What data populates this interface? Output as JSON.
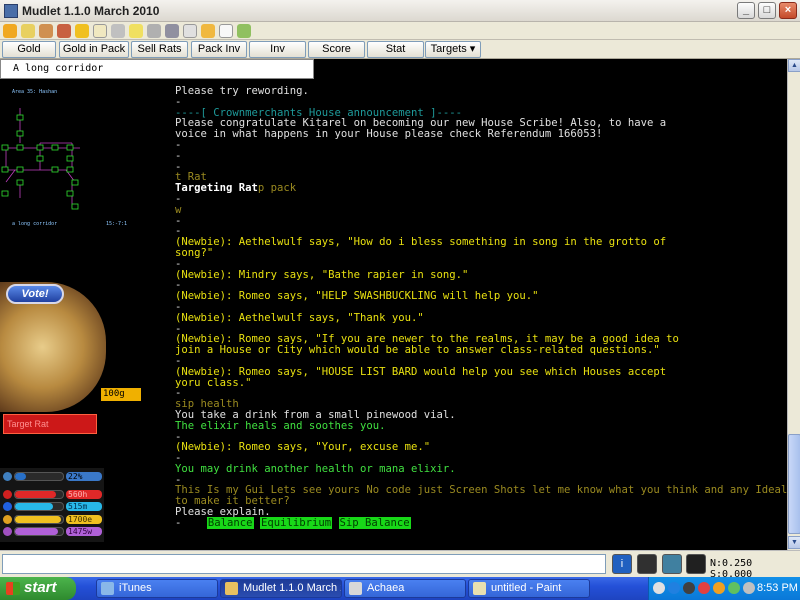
{
  "window": {
    "title": "Mudlet 1.1.0 March 2010",
    "controls": {
      "minimize": "_",
      "maximize": "□",
      "close": "×"
    }
  },
  "toolbar_icons": [
    "power-icon",
    "magic-icon",
    "connect-icon",
    "timer-icon",
    "star-icon",
    "edit-icon",
    "grid-icon",
    "lightbulb-icon",
    "wrench-icon",
    "plugin-icon",
    "help-icon",
    "notepad-icon",
    "window-icon",
    "headphones-icon"
  ],
  "buttons": [
    "Gold",
    "Gold in Pack",
    "Sell Rats",
    "Pack Inv",
    "Inv",
    "Score",
    "Stat"
  ],
  "targets_dropdown": "Targets ▾",
  "room_name": "A long corridor",
  "minimap": {
    "area": "Area 35: Hashan",
    "room": "a long corridor",
    "coords": "15:-7:1"
  },
  "gui": {
    "vote_label": "Vote!",
    "gold": "100g",
    "target": "Target Rat"
  },
  "stats": {
    "percent": "22%",
    "health": "560h",
    "mana": "515m",
    "endurance": "1700e",
    "willpower": "1475w",
    "health_level": 0.85,
    "mana_level": 0.8,
    "endurance_level": 0.95,
    "willpower_level": 0.9,
    "percent_level": 0.22
  },
  "output_lines": [
    {
      "t": "Please try rewording.",
      "c": "c-w"
    },
    {
      "t": "-",
      "c": "c-w"
    },
    {
      "t": "----[ Crownmerchants House announcement ]----",
      "c": "c-b"
    },
    {
      "t": "Please congratulate Kitarel on becoming our new House Scribe! Also, to have a",
      "c": "c-w"
    },
    {
      "t": "voice in what happens in your House please check Referendum 166053!",
      "c": "c-w"
    },
    {
      "t": "-",
      "c": "c-w"
    },
    {
      "t": "-",
      "c": "c-w"
    },
    {
      "t": "-",
      "c": "c-w"
    },
    {
      "t": "t Rat",
      "c": "c-o"
    },
    {
      "t": "Targeting Rat",
      "c": "bold",
      "after": "p pack",
      "after_c": "c-o"
    },
    {
      "t": "-",
      "c": "c-w"
    },
    {
      "t": "w",
      "c": "c-o"
    },
    {
      "t": "-",
      "c": "c-w"
    },
    {
      "t": "-",
      "c": "c-w"
    },
    {
      "t": "(Newbie): Aethelwulf says, \"How do i bless something in song in the grotto of",
      "c": "c-y"
    },
    {
      "t": "song?\"",
      "c": "c-y"
    },
    {
      "t": "-",
      "c": "c-w"
    },
    {
      "t": "(Newbie): Mindry says, \"Bathe rapier in song.\"",
      "c": "c-y"
    },
    {
      "t": "-",
      "c": "c-w"
    },
    {
      "t": "(Newbie): Romeo says, \"HELP SWASHBUCKLING will help you.\"",
      "c": "c-y"
    },
    {
      "t": "-",
      "c": "c-w"
    },
    {
      "t": "(Newbie): Aethelwulf says, \"Thank you.\"",
      "c": "c-y"
    },
    {
      "t": "-",
      "c": "c-w"
    },
    {
      "t": "(Newbie): Romeo says, \"If you are newer to the realms, it may be a good idea to",
      "c": "c-y"
    },
    {
      "t": "join a House or City which would be able to answer class-related questions.\"",
      "c": "c-y"
    },
    {
      "t": "-",
      "c": "c-w"
    },
    {
      "t": "(Newbie): Romeo says, \"HOUSE LIST BARD would help you see which Houses accept",
      "c": "c-y"
    },
    {
      "t": "yoru class.\"",
      "c": "c-y"
    },
    {
      "t": "-",
      "c": "c-w"
    },
    {
      "t": "sip health",
      "c": "c-o"
    },
    {
      "t": "You take a drink from a small pinewood vial.",
      "c": "c-w"
    },
    {
      "t": "The elixir heals and soothes you.",
      "c": "c-g"
    },
    {
      "t": "-",
      "c": "c-w"
    },
    {
      "t": "(Newbie): Romeo says, \"Your, excuse me.\"",
      "c": "c-y"
    },
    {
      "t": "-",
      "c": "c-w"
    },
    {
      "t": "You may drink another health or mana elixir.",
      "c": "c-g"
    },
    {
      "t": "-",
      "c": "c-w"
    },
    {
      "t": "This Is my Gui Lets see yours No code just Screen Shots let me know what you think and any Ideals",
      "c": "c-o"
    },
    {
      "t": "to make it better?",
      "c": "c-o"
    },
    {
      "t": "Please explain.",
      "c": "c-w"
    }
  ],
  "prompt_prefix": "-",
  "prompt_badges": [
    "Balance",
    "Equilibrium",
    "Sip Balance"
  ],
  "status_buttons": [
    "info-icon",
    "keyboard-icon",
    "chat-icon",
    "mudlet-icon"
  ],
  "netstat": "N:0.250 S:0.000",
  "taskbar": {
    "start": "start",
    "tasks": [
      {
        "label": "iTunes",
        "icon_color": "#8ab8e8"
      },
      {
        "label": "Mudlet 1.1.0 March 2...",
        "icon_color": "#e8c060"
      },
      {
        "label": "Achaea",
        "icon_color": "#d8d8d8"
      },
      {
        "label": "untitled - Paint",
        "icon_color": "#e8e0b0"
      }
    ],
    "clock": "8:53 PM"
  }
}
